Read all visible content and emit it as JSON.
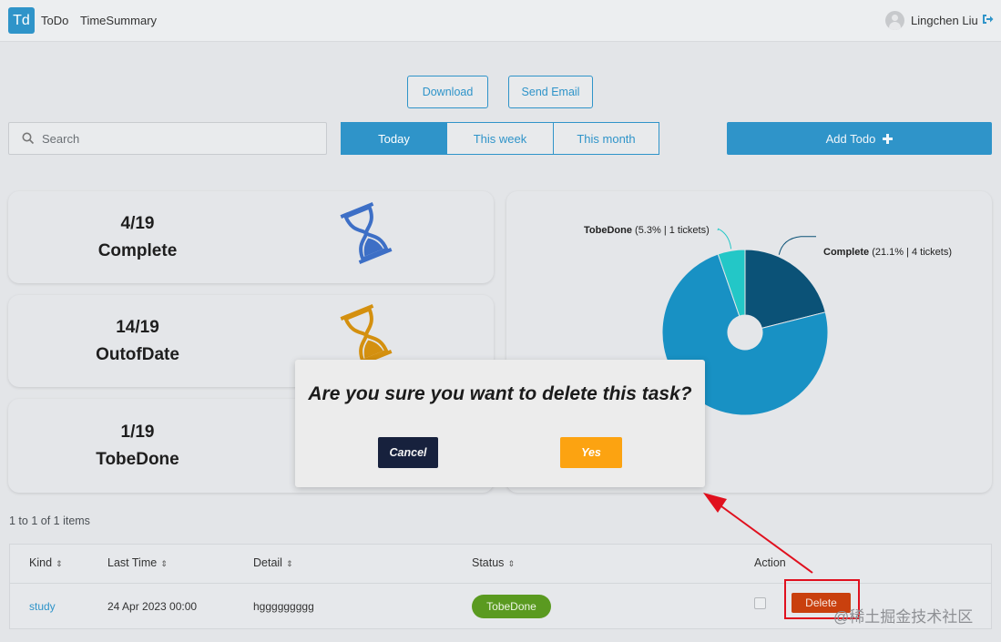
{
  "header": {
    "logo_text": "Td",
    "nav": [
      "ToDo",
      "TimeSummary"
    ],
    "user_name": "Lingchen Liu"
  },
  "toolbar": {
    "download_label": "Download",
    "send_email_label": "Send Email",
    "search_placeholder": "Search",
    "range_tabs": [
      "Today",
      "This week",
      "This month"
    ],
    "active_tab": "Today",
    "add_todo_label": "Add Todo"
  },
  "stats": [
    {
      "value": "4/19",
      "label": "Complete",
      "icon": "hourglass-icon",
      "color": "#3d6fc6"
    },
    {
      "value": "14/19",
      "label": "OutofDate",
      "icon": "hourglass-icon",
      "color": "#d4900f"
    },
    {
      "value": "1/19",
      "label": "TobeDone",
      "icon": "hourglass-icon",
      "color": "#2aa6a6"
    }
  ],
  "chart_data": {
    "type": "pie",
    "donut": true,
    "slices": [
      {
        "name": "Complete",
        "percent": 21.1,
        "tickets": 4,
        "color": "#0b5277"
      },
      {
        "name": "OutofDate",
        "percent": 73.7,
        "tickets": 14,
        "color": "#1891c4"
      },
      {
        "name": "TobeDone",
        "percent": 5.3,
        "tickets": 1,
        "color": "#23c7c7"
      }
    ],
    "labels": {
      "complete": {
        "name": "Complete",
        "detail": "(21.1% | 4 tickets)"
      },
      "tobedone": {
        "name": "TobeDone",
        "detail": "(5.3% | 1 tickets)"
      }
    }
  },
  "list": {
    "pager_text": "1 to 1 of 1 items",
    "columns": [
      "Kind",
      "Last Time",
      "Detail",
      "Status",
      "Action"
    ],
    "rows": [
      {
        "kind": "study",
        "last_time": "24 Apr 2023 00:00",
        "detail": "hggggggggg",
        "status": "TobeDone",
        "action": "Delete"
      }
    ]
  },
  "dialog": {
    "title": "Are you sure you want to delete this task?",
    "cancel_label": "Cancel",
    "yes_label": "Yes"
  },
  "watermark": "@稀土掘金技术社区",
  "colors": {
    "primary": "#2f94c9",
    "delete": "#c9400e",
    "status_badge": "#5a9a20",
    "cancel": "#17213d",
    "yes": "#fca311",
    "annotation": "#e0101e"
  }
}
